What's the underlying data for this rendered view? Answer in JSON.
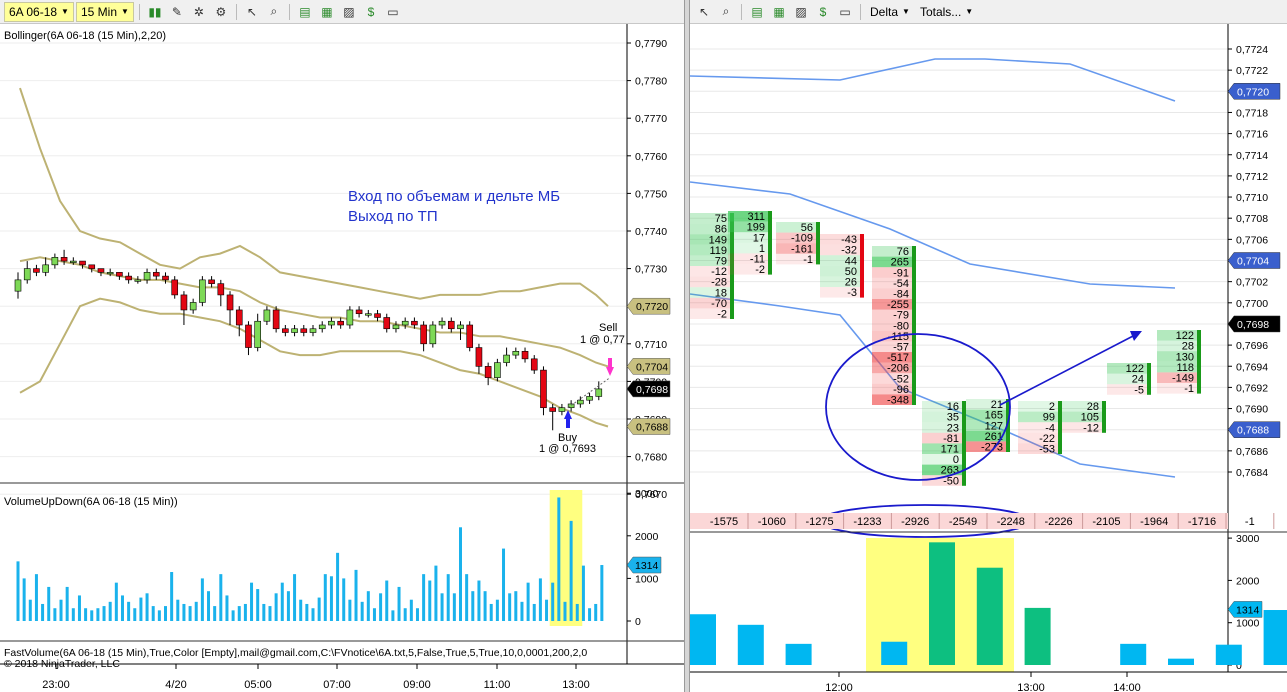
{
  "left": {
    "toolbar": {
      "instrument": "6A 06-18",
      "interval": "15 Min"
    },
    "price_indicator_label": "Bollinger(6A 06-18 (15 Min),2,20)",
    "annotation_lines": [
      "Вход по объемам и дельте МБ",
      "Выход по ТП"
    ],
    "price_axis_ticks": [
      "0,7790",
      "0,7780",
      "0,7770",
      "0,7760",
      "0,7750",
      "0,7740",
      "0,7730",
      "0,7720",
      "0,7710",
      "0,7700",
      "0,7690",
      "0,7680",
      "0,7670"
    ],
    "price_markers": [
      {
        "value": "0,7720",
        "color": "#c8c080"
      },
      {
        "value": "0,7704",
        "color": "#c8c080"
      },
      {
        "value": "0,7698",
        "color": "#000000"
      },
      {
        "value": "0,7688",
        "color": "#c8c080"
      }
    ],
    "trades": {
      "sell_label": "Sell",
      "sell_detail": "1 @ 0,77",
      "buy_label": "Buy",
      "buy_detail": "1 @ 0,7693"
    },
    "volume_panel_label": "VolumeUpDown(6A 06-18 (15 Min))",
    "volume_axis_ticks": [
      "3000",
      "2000",
      "1000",
      "0"
    ],
    "volume_marker": "1314",
    "footer_line1": "FastVolume(6A 06-18 (15 Min),True,Color [Empty],mail@gmail.com,C:\\FVnotice\\6A.txt,5,False,True,5,True,10,0,0001,200,2,0",
    "footer_line2": "© 2018 NinjaTrader, LLC",
    "time_axis": [
      "23:00",
      "4/20",
      "05:00",
      "07:00",
      "09:00",
      "11:00",
      "13:00"
    ],
    "volume_bars": [
      1400,
      1000,
      500,
      1100,
      400,
      800,
      300,
      500,
      800,
      300,
      600,
      300,
      250,
      300,
      350,
      450,
      900,
      600,
      450,
      300,
      550,
      650,
      350,
      250,
      350,
      1150,
      500,
      400,
      350,
      450,
      1000,
      700,
      350,
      1100,
      600,
      250,
      350,
      400,
      900,
      750,
      400,
      350,
      650,
      900,
      700,
      1100,
      500,
      400,
      300,
      550,
      1100,
      1050,
      1600,
      1000,
      500,
      1200,
      450,
      700,
      300,
      650,
      950,
      250,
      800,
      300,
      500,
      300,
      1100,
      950,
      1300,
      650,
      1100,
      650,
      2200,
      1100,
      700,
      950,
      700,
      400,
      500,
      1700,
      650,
      700,
      450,
      900,
      400,
      1000,
      500,
      900,
      2900,
      450,
      2350,
      400,
      1300,
      300,
      400,
      1314
    ],
    "volume_highlight": [
      87,
      91
    ]
  },
  "right": {
    "toolbar": {
      "mode": "Delta",
      "totals": "Totals..."
    },
    "price_axis_ticks": [
      "0,7724",
      "0,7722",
      "0,7720",
      "0,7718",
      "0,7716",
      "0,7714",
      "0,7712",
      "0,7710",
      "0,7708",
      "0,7706",
      "0,7704",
      "0,7702",
      "0,7700",
      "0,7698",
      "0,7696",
      "0,7694",
      "0,7692",
      "0,7690",
      "0,7688",
      "0,7686",
      "0,7684"
    ],
    "price_markers": [
      {
        "value": "0,7720",
        "color": "#3a5fcd"
      },
      {
        "value": "0,7704",
        "color": "#3a5fcd"
      },
      {
        "value": "0,7698",
        "color": "#000000"
      },
      {
        "value": "0,7688",
        "color": "#3a5fcd"
      }
    ],
    "delta_totals": [
      "-1575",
      "-1060",
      "-1275",
      "-1233",
      "-2926",
      "-2549",
      "-2248",
      "-2226",
      "-2105",
      "-1964",
      "-1716",
      "-1"
    ],
    "volume_axis_ticks": [
      "3000",
      "2000",
      "1000",
      "0"
    ],
    "volume_marker": "1314",
    "time_axis": [
      "12:00",
      "13:00",
      "14:00"
    ],
    "volume_bars": [
      1200,
      950,
      500,
      0,
      550,
      2900,
      2300,
      1350,
      0,
      500,
      150,
      480,
      1300
    ],
    "footprint": [
      {
        "col": 0,
        "cells": [
          "75",
          "86",
          "149",
          "119",
          "79",
          "-12",
          "-28",
          "18",
          "-70",
          "-2"
        ]
      },
      {
        "col": 1,
        "cells": [
          "311",
          "199",
          "17",
          "1",
          "-11",
          "-2"
        ]
      },
      {
        "col": 2,
        "cells": [
          "56",
          "-109",
          "-161",
          "-1"
        ]
      },
      {
        "col": 3,
        "cells": [
          "-43",
          "-32",
          "44",
          "50",
          "26",
          "-3"
        ]
      },
      {
        "col": 4,
        "cells": [
          "76",
          "265",
          "-91",
          "-54",
          "-84",
          "-255",
          "-79",
          "-80",
          "-115",
          "-57",
          "-517",
          "-206",
          "-52",
          "-96",
          "-348"
        ]
      },
      {
        "col": 5,
        "cells": [
          "16",
          "35",
          "23",
          "-81",
          "171",
          "0",
          "263",
          "-50"
        ]
      },
      {
        "col": 6,
        "cells": [
          "21",
          "165",
          "127",
          "261",
          "-273"
        ]
      },
      {
        "col": 7,
        "cells": [
          "2",
          "99",
          "-4",
          "-22",
          "-53"
        ]
      },
      {
        "col": 8,
        "cells": [
          "28",
          "105",
          "-12"
        ]
      },
      {
        "col": 9,
        "cells": [
          "122",
          "24",
          "-5"
        ]
      },
      {
        "col": 10,
        "cells": [
          "122",
          "28",
          "130",
          "118",
          "-149",
          "-1"
        ]
      }
    ]
  }
}
